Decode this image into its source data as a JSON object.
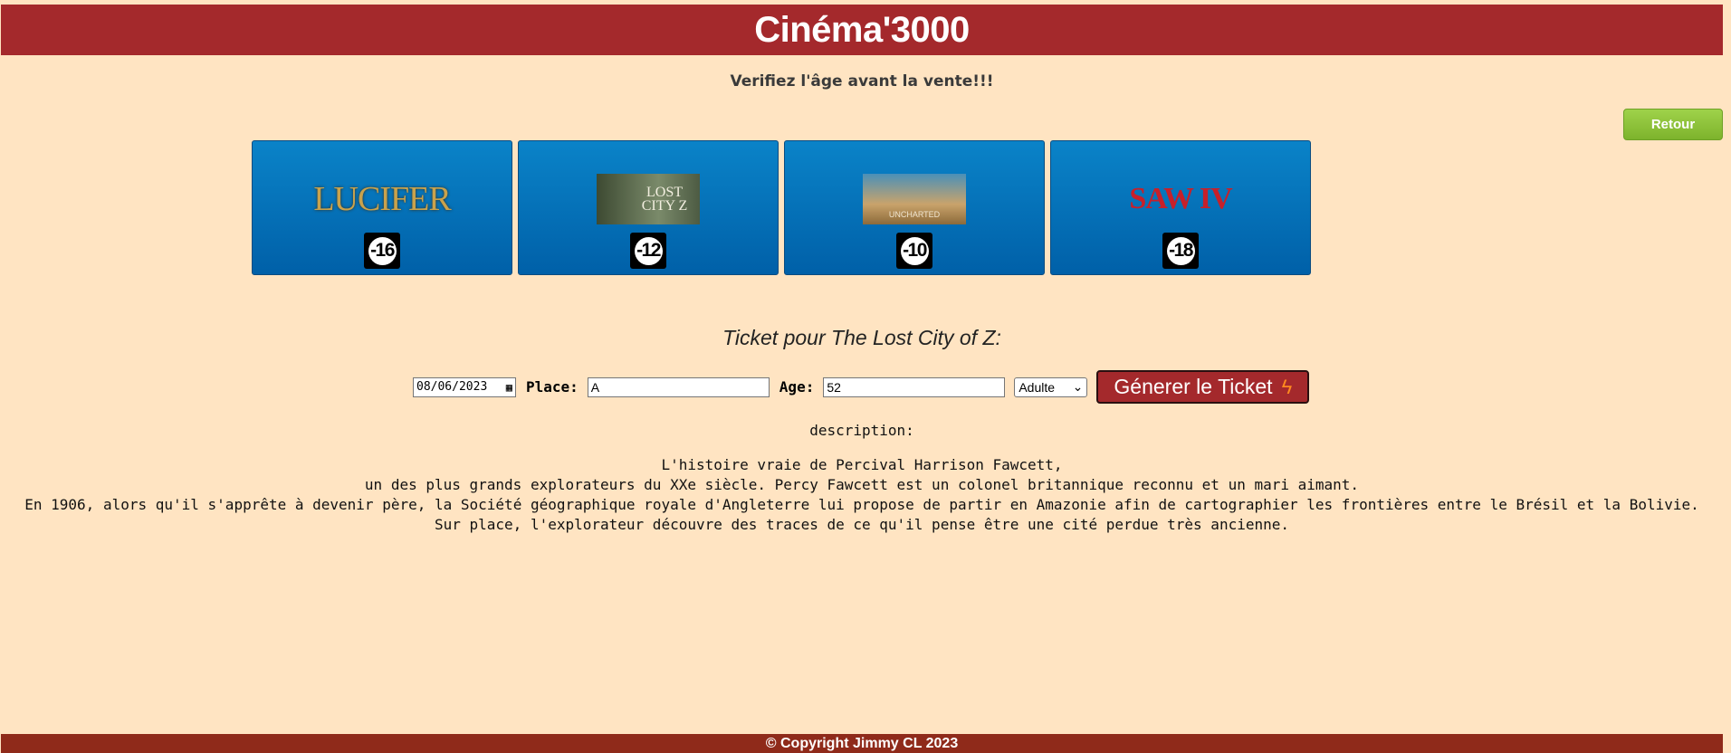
{
  "header": {
    "title": "Cinéma'3000"
  },
  "warning": "Verifiez l'âge avant la vente!!!",
  "retour_label": "Retour",
  "films": [
    {
      "poster_text": "LUCIFER",
      "age": "-16"
    },
    {
      "poster_text": "LOST CITY Z",
      "age": "-12"
    },
    {
      "poster_text": "UNCHARTED",
      "age": "-10"
    },
    {
      "poster_text": "SAW IV",
      "age": "-18"
    }
  ],
  "ticket_title": "Ticket pour The Lost City of Z:",
  "form": {
    "date_value": "08/06/2023",
    "place_label": "Place:",
    "place_value": "A",
    "age_label": "Age:",
    "age_value": "52",
    "category_selected": "Adulte",
    "generate_label": "Génerer le Ticket"
  },
  "description": {
    "label": "description:",
    "lines": [
      "L'histoire vraie de Percival Harrison Fawcett,",
      "un des plus grands explorateurs du XXe siècle. Percy Fawcett est un colonel britannique reconnu et un mari aimant.",
      "En 1906, alors qu'il s'apprête à devenir père, la Société géographique royale d'Angleterre lui propose de partir en Amazonie afin de cartographier les frontières entre le Brésil et la Bolivie.",
      "Sur place, l'explorateur découvre des traces de ce qu'il pense être une cité perdue très ancienne."
    ]
  },
  "footer": "© Copyright Jimmy CL 2023",
  "colors": {
    "background": "#ffe4c2",
    "header": "#a4292c",
    "tile": "#0a83c8",
    "retour": "#8cc63f",
    "footer": "#8f2a1a"
  }
}
